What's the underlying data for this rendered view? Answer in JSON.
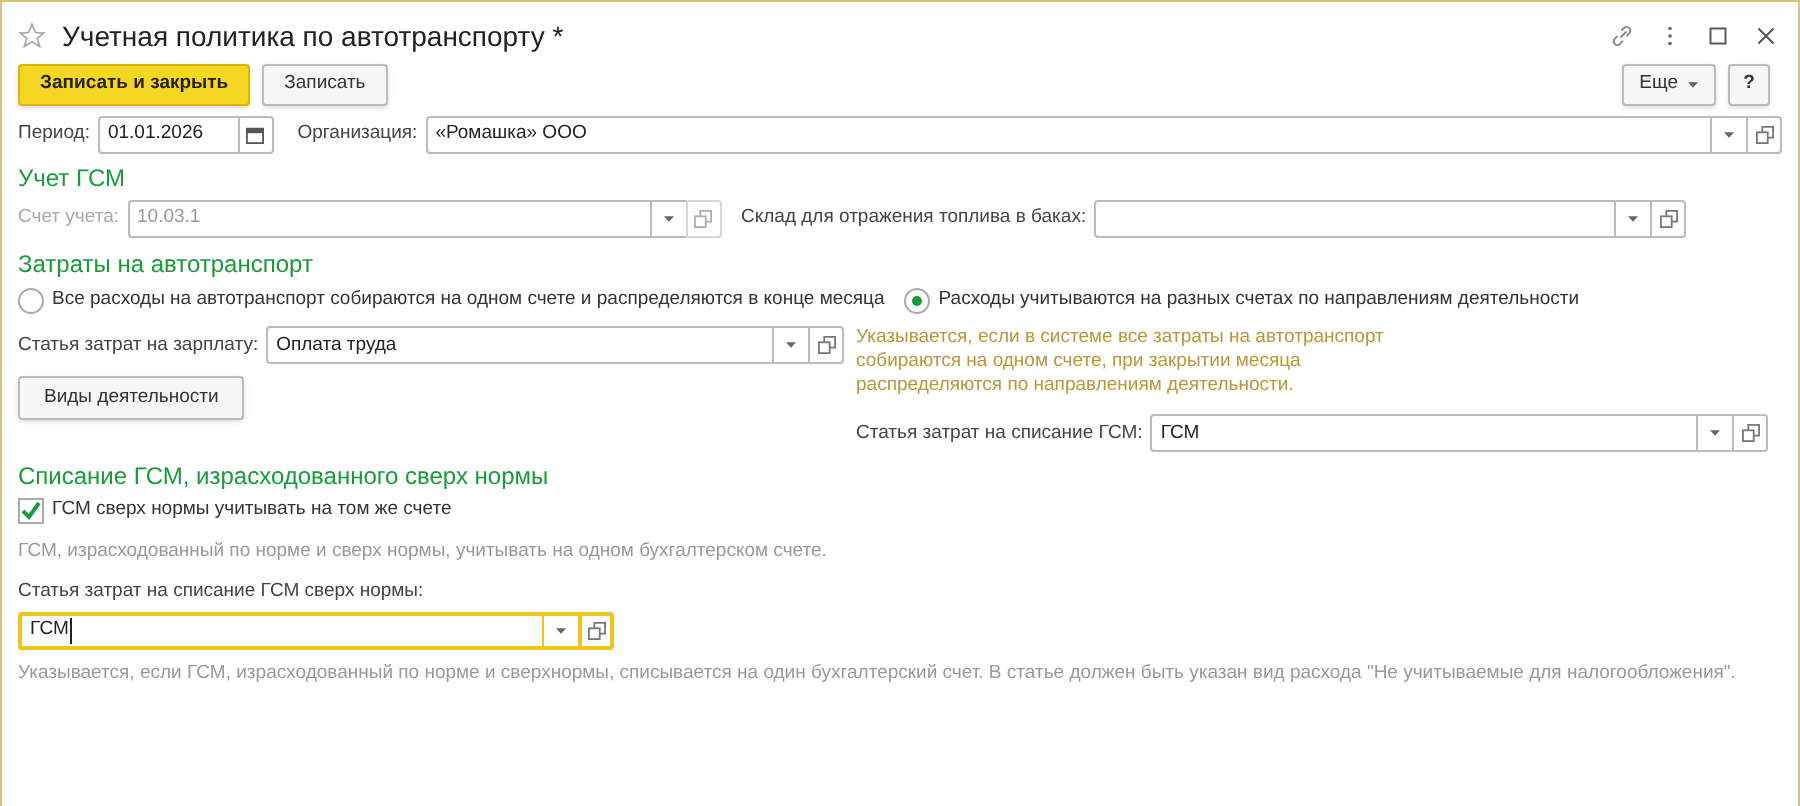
{
  "window": {
    "title": "Учетная политика по автотранспорту *",
    "favorite": false
  },
  "toolbar": {
    "buttons": [
      {
        "label": "Записать и закрыть",
        "kind": "primary"
      },
      {
        "label": "Записать",
        "kind": "default"
      }
    ],
    "more": "Еще",
    "help": "?"
  },
  "period": {
    "label": "Период:",
    "value": "01.01.2026"
  },
  "organization": {
    "label": "Организация:",
    "value": "«Ромашка» ООО"
  },
  "fuel_accounting": {
    "heading": "Учет ГСМ",
    "account": {
      "label": "Счет учета:",
      "value": "10.03.1",
      "disabled": true
    },
    "warehouse": {
      "label": "Склад для отражения топлива в баках:"
    }
  },
  "vehicle_costs": {
    "heading": "Затраты на автотранспорт",
    "options": [
      {
        "label": "Все расходы на автотранспорт собираются на одном счете и распределяются в конце месяца",
        "selected": false
      },
      {
        "label": "Расходы учитываются на разных счетах по направлениям деятельности",
        "selected": true
      }
    ],
    "salary_item": {
      "label": "Статья затрат на зарплату:",
      "value": "Оплата труда"
    },
    "hint": "Указывается, если в системе все затраты на автотранспорт собираются на одном счете, при закрытии месяца распределяются по направлениям деятельности.",
    "activities_button": "Виды деятельности",
    "fuel_item": {
      "label": "Статья затрат на списание ГСМ:",
      "value": "ГСМ"
    }
  },
  "overnorm": {
    "heading": "Списание ГСМ, израсходованного сверх нормы",
    "same_account": {
      "label": "ГСМ сверх нормы учитывать на том же счете",
      "checked": true
    },
    "note": "ГСМ, израсходованный по норме и сверх нормы, учитывать на одном бухгалтерском счете.",
    "item": {
      "label": "Статья затрат на списание ГСМ сверх нормы:",
      "value": "ГСМ",
      "focused": true
    },
    "footnote": "Указывается, если ГСМ, израсходованный по норме и сверхнормы, списывается на один бухгалтерский счет. В статье должен быть указан вид расхода \"Не учитываемые для налогообложения\"."
  }
}
